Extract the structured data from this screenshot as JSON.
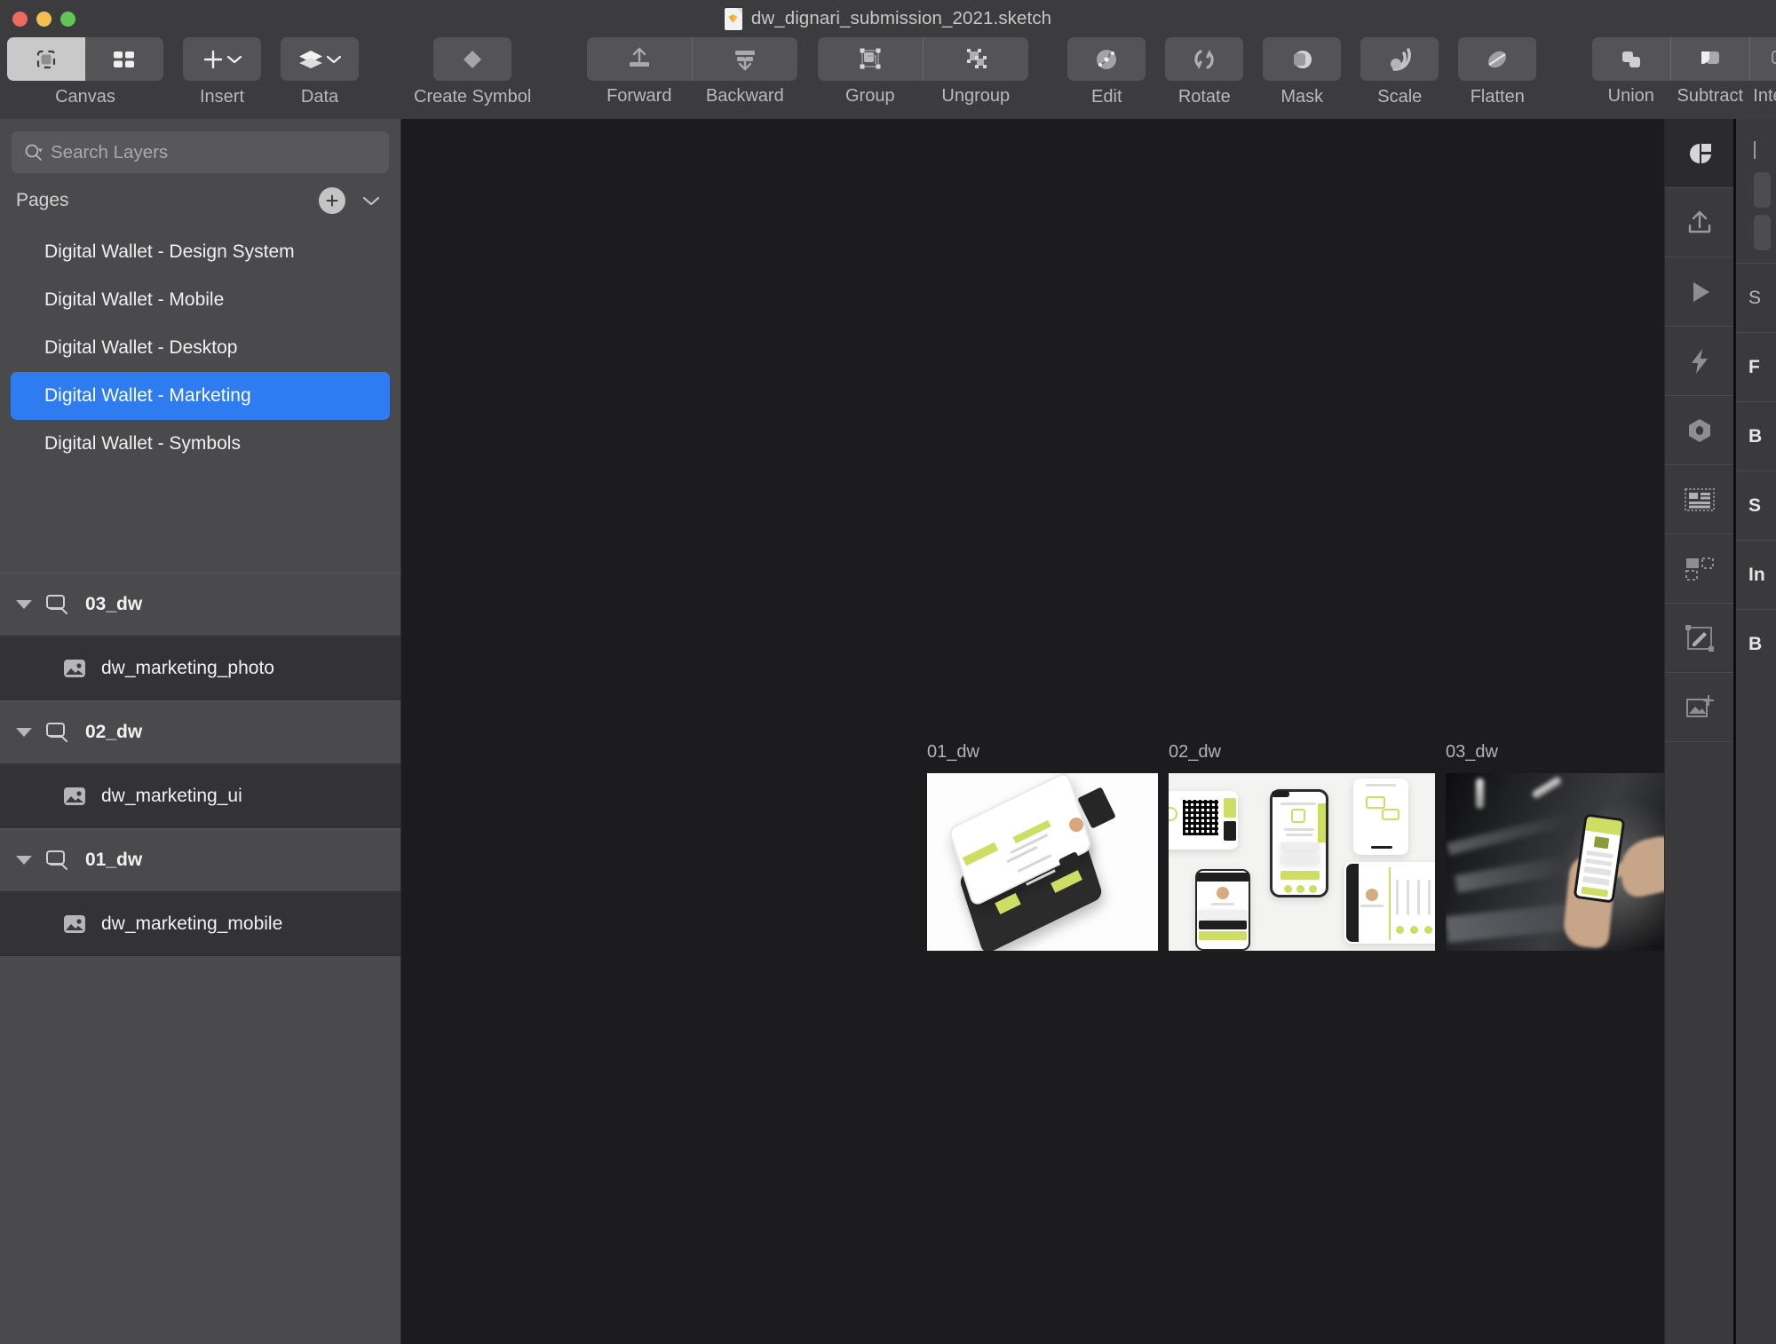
{
  "window": {
    "title": "dw_dignari_submission_2021.sketch",
    "file_icon": "sketch-document-icon",
    "traffic_lights": [
      {
        "name": "close",
        "color": "#ed6a5f"
      },
      {
        "name": "minimize",
        "color": "#f4bf4f"
      },
      {
        "name": "zoom",
        "color": "#61c454"
      }
    ]
  },
  "toolbar": {
    "groups": [
      {
        "name": "canvas",
        "label": "Canvas",
        "buttons": [
          {
            "icon": "artboard-view-icon",
            "active": true
          },
          {
            "icon": "grid-view-icon",
            "active": false
          }
        ]
      },
      {
        "name": "insert",
        "label": "Insert",
        "buttons": [
          {
            "icon": "plus-icon",
            "chevron": true
          }
        ]
      },
      {
        "name": "data",
        "label": "Data",
        "buttons": [
          {
            "icon": "layers-stack-icon",
            "chevron": true
          }
        ]
      },
      {
        "name": "create-symbol",
        "label": "Create Symbol",
        "buttons": [
          {
            "icon": "symbol-diamond-icon"
          }
        ]
      },
      {
        "name": "arrange",
        "labels": [
          "Forward",
          "Backward"
        ],
        "buttons": [
          {
            "icon": "bring-forward-icon"
          },
          {
            "icon": "send-backward-icon"
          }
        ]
      },
      {
        "name": "grouping",
        "labels": [
          "Group",
          "Ungroup"
        ],
        "buttons": [
          {
            "icon": "group-icon"
          },
          {
            "icon": "ungroup-icon"
          }
        ]
      },
      {
        "name": "transform",
        "labels": [
          "Edit",
          "Rotate",
          "Mask",
          "Scale",
          "Flatten"
        ],
        "buttons": [
          {
            "icon": "edit-vector-icon"
          },
          {
            "icon": "rotate-icon"
          },
          {
            "icon": "mask-icon"
          },
          {
            "icon": "scale-icon"
          },
          {
            "icon": "flatten-icon"
          }
        ]
      },
      {
        "name": "boolean",
        "labels": [
          "Union",
          "Subtract",
          "Inte"
        ],
        "buttons": [
          {
            "icon": "union-icon"
          },
          {
            "icon": "subtract-icon"
          },
          {
            "icon": "intersect-icon"
          }
        ]
      }
    ]
  },
  "sidebar": {
    "search": {
      "placeholder": "Search Layers",
      "value": "",
      "icon": "search-icon"
    },
    "pages": {
      "title": "Pages",
      "add_icon": "plus-icon",
      "menu_icon": "chevron-down-icon",
      "items": [
        {
          "label": "Digital Wallet - Design System",
          "selected": false
        },
        {
          "label": "Digital Wallet - Mobile",
          "selected": false
        },
        {
          "label": "Digital Wallet - Desktop",
          "selected": false
        },
        {
          "label": "Digital Wallet - Marketing",
          "selected": true
        },
        {
          "label": "Digital Wallet - Symbols",
          "selected": false
        }
      ],
      "selected_color": "#2f7bf0"
    },
    "layers": [
      {
        "name": "03_dw",
        "type": "artboard",
        "expanded": true,
        "icon": "artboard-icon"
      },
      {
        "name": "dw_marketing_photo",
        "type": "image",
        "icon": "image-icon"
      },
      {
        "name": "02_dw",
        "type": "artboard",
        "expanded": true,
        "icon": "artboard-icon"
      },
      {
        "name": "dw_marketing_ui",
        "type": "image",
        "icon": "image-icon"
      },
      {
        "name": "01_dw",
        "type": "artboard",
        "expanded": true,
        "icon": "artboard-icon"
      },
      {
        "name": "dw_marketing_mobile",
        "type": "image",
        "icon": "image-icon"
      }
    ]
  },
  "canvas": {
    "background": "#1c1c1e",
    "artboards": [
      {
        "label": "01_dw",
        "content": "isometric phone mockup on white"
      },
      {
        "label": "02_dw",
        "content": "grid of digital wallet app screens"
      },
      {
        "label": "03_dw",
        "content": "photo of hand holding phone in subway"
      }
    ]
  },
  "right_rail": {
    "buttons": [
      {
        "icon": "inspector-icon",
        "active": true
      },
      {
        "icon": "export-icon",
        "active": false
      },
      {
        "icon": "prototype-play-icon",
        "active": false
      },
      {
        "icon": "lightning-icon",
        "active": false
      },
      {
        "icon": "symbol-hex-icon",
        "active": false
      },
      {
        "icon": "text-layout-icon",
        "active": false
      },
      {
        "icon": "selection-icon",
        "active": false
      },
      {
        "icon": "edit-shape-icon",
        "active": false
      },
      {
        "icon": "add-image-icon",
        "active": false
      }
    ]
  },
  "inspector": {
    "sections": [
      "S",
      "F",
      "B",
      "S",
      "In",
      "B"
    ]
  }
}
